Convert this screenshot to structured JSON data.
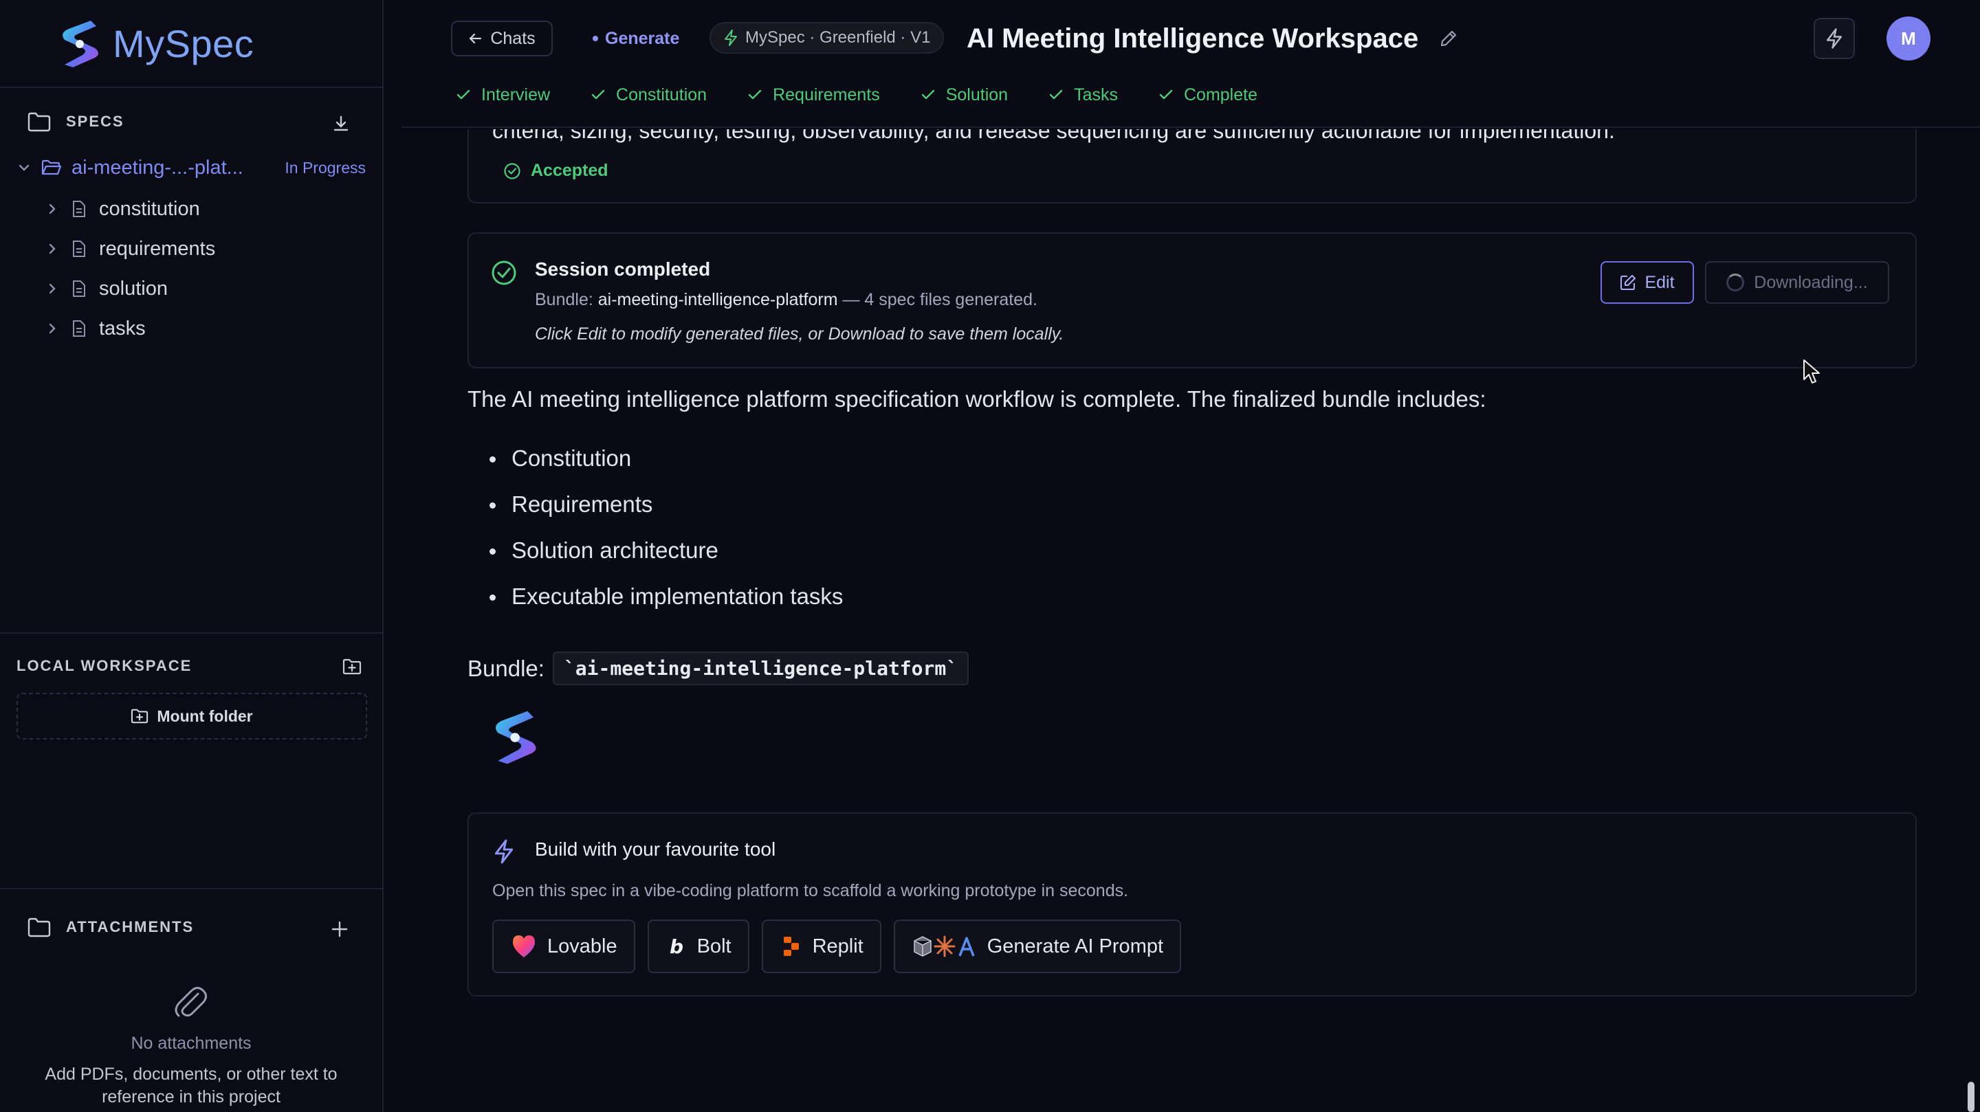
{
  "colors": {
    "accent": "#7f8cf6",
    "success": "#4ecb7a",
    "background": "#0a0a14",
    "border": "#1e1f2e",
    "avatar": "#7b7ff0"
  },
  "sidebar": {
    "brand": "MySpec",
    "specs": {
      "heading": "SPECS",
      "root": {
        "label": "ai-meeting-...-plat...",
        "status": "In Progress"
      },
      "items": [
        {
          "label": "constitution"
        },
        {
          "label": "requirements"
        },
        {
          "label": "solution"
        },
        {
          "label": "tasks"
        }
      ]
    },
    "workspace": {
      "heading": "LOCAL WORKSPACE",
      "mount_label": "Mount folder"
    },
    "attachments": {
      "heading": "ATTACHMENTS",
      "empty_title": "No attachments",
      "empty_desc": "Add PDFs, documents, or other text to reference in this project"
    }
  },
  "header": {
    "chats_label": "Chats",
    "generate_label": "Generate",
    "pill_label": "MySpec · Greenfield · V1",
    "title": "AI Meeting Intelligence Workspace",
    "avatar_initial": "M",
    "steps": [
      {
        "label": "Interview"
      },
      {
        "label": "Constitution"
      },
      {
        "label": "Requirements"
      },
      {
        "label": "Solution"
      },
      {
        "label": "Tasks"
      },
      {
        "label": "Complete"
      }
    ]
  },
  "main": {
    "cut_text": "criteria, sizing, security, testing, observability, and release sequencing are sufficiently actionable for implementation.",
    "accepted_label": "Accepted",
    "session": {
      "title": "Session completed",
      "bundle_prefix": "Bundle:",
      "bundle_name": "ai-meeting-intelligence-platform",
      "bundle_suffix": "— 4 spec files generated.",
      "hint": "Click Edit to modify generated files, or Download to save them locally.",
      "edit_label": "Edit",
      "download_label": "Downloading..."
    },
    "paragraph": "The AI meeting intelligence platform specification workflow is complete. The finalized bundle includes:",
    "bullets": [
      "Constitution",
      "Requirements",
      "Solution architecture",
      "Executable implementation tasks"
    ],
    "bundle_label": "Bundle:",
    "bundle_code": "`ai-meeting-intelligence-platform`",
    "build": {
      "title": "Build with your favourite tool",
      "desc": "Open this spec in a vibe-coding platform to scaffold a working prototype in seconds.",
      "tools": [
        {
          "label": "Lovable",
          "icon": "lovable-icon"
        },
        {
          "label": "Bolt",
          "icon": "bolt-brand-icon"
        },
        {
          "label": "Replit",
          "icon": "replit-icon"
        },
        {
          "label": "Generate AI Prompt",
          "icon": "ai-tools-icon"
        }
      ]
    }
  }
}
